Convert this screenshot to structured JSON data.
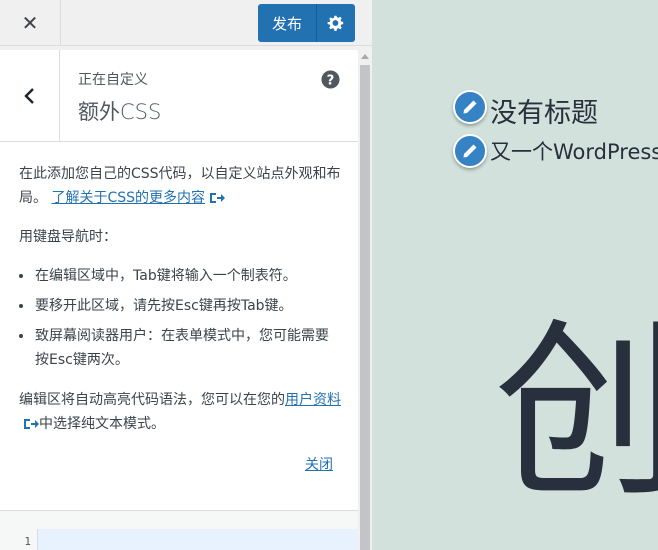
{
  "topbar": {
    "close_symbol": "✕",
    "publish_label": "发布",
    "gear_icon": "gear-icon"
  },
  "section": {
    "customizing_label": "正在自定义",
    "title": "额外CSS",
    "help_icon": "help-icon"
  },
  "description": {
    "intro": "在此添加您自己的CSS代码，以自定义站点外观和布局。",
    "learn_more_link": "了解关于CSS的更多内容",
    "keyboard_title": "用键盘导航时：",
    "bullets": [
      "在编辑区域中，Tab键将输入一个制表符。",
      "要移开此区域，请先按Esc键再按Tab键。",
      "致屏幕阅读器用户：在表单模式中，您可能需要按Esc键两次。"
    ],
    "highlight_text_before": "编辑区将自动高亮代码语法，您可以在您的",
    "profile_link": "用户资料",
    "highlight_text_after": "中选择纯文本模式。",
    "close_link": "关闭"
  },
  "editor": {
    "line_number": "1"
  },
  "preview": {
    "site_title": "没有标题",
    "site_description": "又一个WordPress站点",
    "heading_fragment": "创"
  },
  "colors": {
    "accent": "#2271b1",
    "preview_bg": "#d2e1dc",
    "edit_badge": "#3582c4"
  }
}
